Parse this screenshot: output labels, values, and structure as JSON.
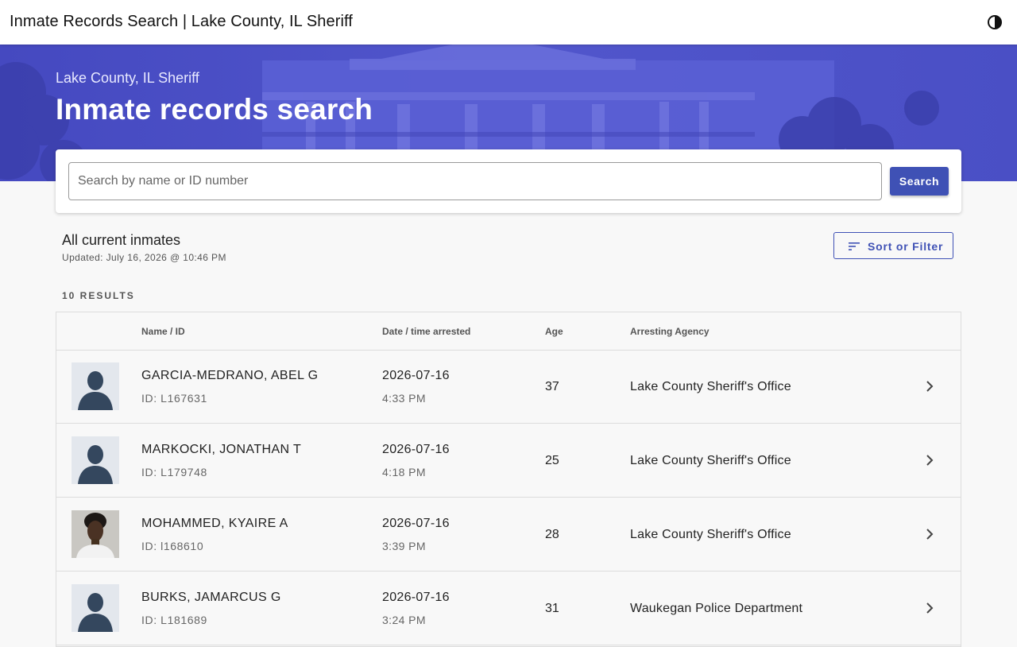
{
  "page": {
    "title": "Inmate Records Search | Lake County, IL Sheriff",
    "theme_toggle_icon": "half-moon-icon"
  },
  "hero": {
    "subtitle": "Lake County, IL Sheriff",
    "title": "Inmate records search",
    "color": "#4b50c6"
  },
  "search": {
    "placeholder": "Search by name or ID number",
    "value": "",
    "button_label": "Search"
  },
  "list": {
    "title": "All current inmates",
    "updated": "Updated: July 16, 2026 @ 10:46 PM",
    "sort_label": "Sort or Filter",
    "sort_icon": "sort-lines-icon",
    "results_count": "10 RESULTS"
  },
  "table": {
    "headers": [
      "Name / ID",
      "Date / time arrested",
      "Age",
      "Arresting Agency"
    ],
    "rows": [
      {
        "name": "GARCIA-MEDRANO, ABEL G",
        "id": "ID: L167631",
        "date": "2026-07-16",
        "time": "4:33 PM",
        "age": "37",
        "agency": "Lake County Sheriff's Office",
        "photo": "silhouette"
      },
      {
        "name": "MARKOCKI, JONATHAN T",
        "id": "ID: L179748",
        "date": "2026-07-16",
        "time": "4:18 PM",
        "age": "25",
        "agency": "Lake County Sheriff's Office",
        "photo": "silhouette"
      },
      {
        "name": "MOHAMMED, KYAIRE A",
        "id": "ID: l168610",
        "date": "2026-07-16",
        "time": "3:39 PM",
        "age": "28",
        "agency": "Lake County Sheriff's Office",
        "photo": "mugshot"
      },
      {
        "name": "BURKS, JAMARCUS G",
        "id": "ID: L181689",
        "date": "2026-07-16",
        "time": "3:24 PM",
        "age": "31",
        "agency": "Waukegan Police Department",
        "photo": "silhouette"
      }
    ]
  },
  "colors": {
    "accent": "#3f51b5",
    "silhouette": "#34475e"
  }
}
